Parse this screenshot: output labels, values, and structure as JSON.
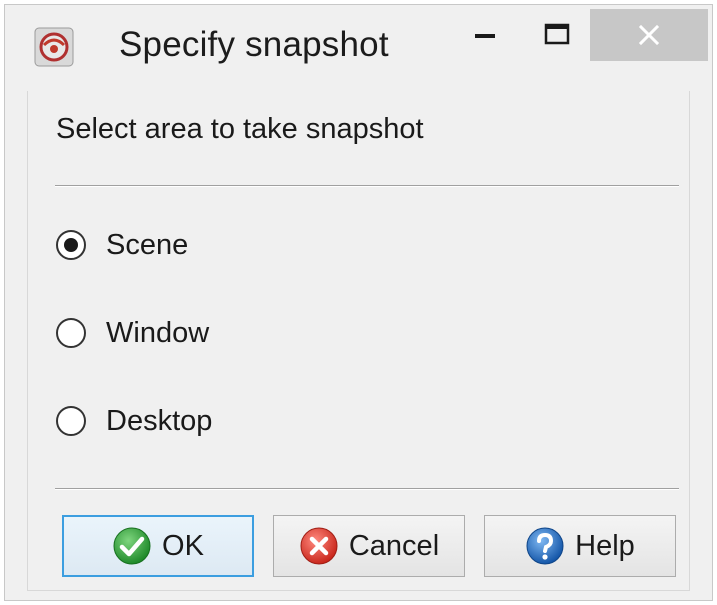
{
  "window": {
    "title": "Specify snapshot",
    "controls": {
      "minimize_icon": "minimize-icon",
      "maximize_icon": "maximize-icon",
      "close_icon": "close-icon"
    }
  },
  "content": {
    "prompt": "Select area to take snapshot",
    "options": [
      {
        "label": "Scene",
        "selected": true
      },
      {
        "label": "Window",
        "selected": false
      },
      {
        "label": "Desktop",
        "selected": false
      }
    ]
  },
  "buttons": {
    "ok": {
      "label": "OK",
      "icon": "check-icon",
      "color": "#2e9e2e"
    },
    "cancel": {
      "label": "Cancel",
      "icon": "cancel-x-icon",
      "color": "#e03c31"
    },
    "help": {
      "label": "Help",
      "icon": "question-icon",
      "color": "#1f6fc8"
    }
  },
  "colors": {
    "window_bg": "#f0f0f0",
    "close_button_bg": "#c7c7c7",
    "default_button_border": "#3c9ee0"
  }
}
